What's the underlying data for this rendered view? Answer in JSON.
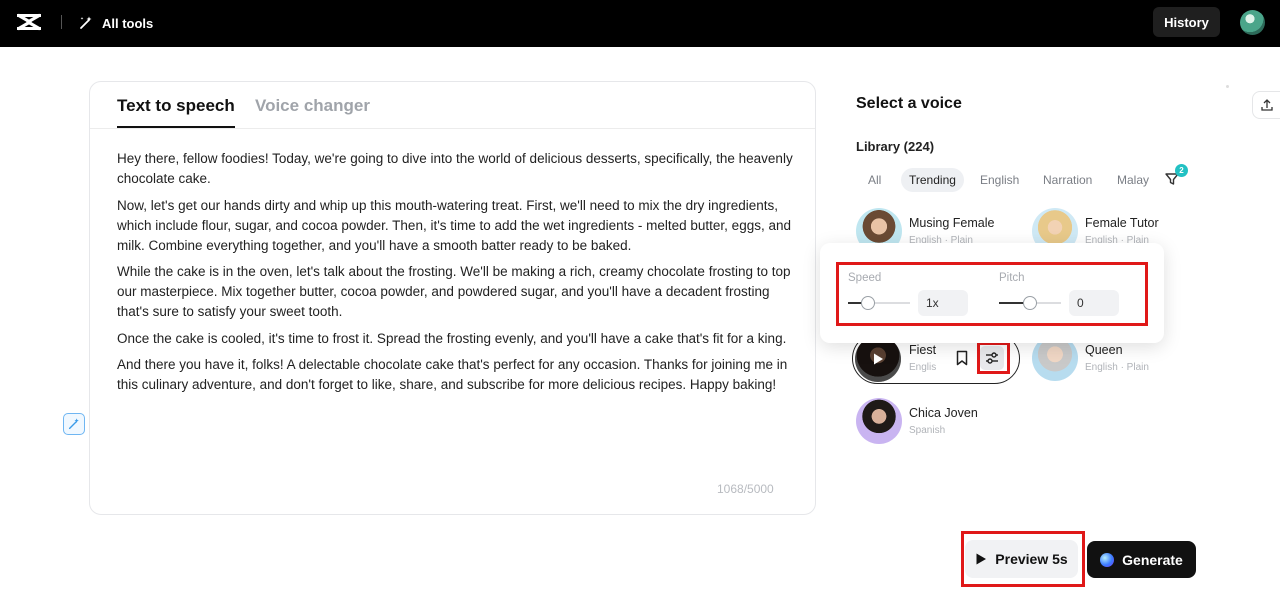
{
  "topbar": {
    "all_tools_label": "All tools",
    "history_label": "History",
    "logo_icon": "capcut-logo-icon",
    "all_tools_icon": "magic-wand-icon"
  },
  "editor": {
    "tabs": [
      {
        "label": "Text to speech",
        "active": true
      },
      {
        "label": "Voice changer",
        "active": false
      }
    ],
    "paragraphs": [
      "Hey there, fellow foodies! Today, we're going to dive into the world of delicious desserts, specifically, the heavenly chocolate cake.",
      "Now, let's get our hands dirty and whip up this mouth-watering treat. First, we'll need to mix the dry ingredients, which include flour, sugar, and cocoa powder. Then, it's time to add the wet ingredients - melted butter, eggs, and milk. Combine everything together, and you'll have a smooth batter ready to be baked.",
      "While the cake is in the oven, let's talk about the frosting. We'll be making a rich, creamy chocolate frosting to top our masterpiece. Mix together butter, cocoa powder, and powdered sugar, and you'll have a decadent frosting that's sure to satisfy your sweet tooth.",
      "Once the cake is cooled, it's time to frost it. Spread the frosting evenly, and you'll have a cake that's fit for a king.",
      "And there you have it, folks! A delectable chocolate cake that's perfect for any occasion. Thanks for joining me in this culinary adventure, and don't forget to like, share, and subscribe for more delicious recipes. Happy baking!"
    ],
    "char_count": "1068/5000"
  },
  "voice_panel": {
    "title": "Select a voice",
    "library_label": "Library (224)",
    "filters": [
      "All",
      "Trending",
      "English",
      "Narration",
      "Malay"
    ],
    "active_filter": "Trending",
    "filter_badge": "2",
    "voices": [
      {
        "name": "Musing Female",
        "meta": "English · Plain"
      },
      {
        "name": "Female Tutor",
        "meta": "English · Plain"
      },
      {
        "name": "Fiesta",
        "meta": "English"
      },
      {
        "name": "Queen",
        "meta": "English · Plain"
      },
      {
        "name": "Chica Joven",
        "meta": "Spanish"
      }
    ],
    "selected_voice_short": "Fiest",
    "selected_voice_meta_short": "Englis"
  },
  "settings_popup": {
    "speed_label": "Speed",
    "speed_value": "1x",
    "speed_level": 0.33,
    "pitch_label": "Pitch",
    "pitch_value": "0",
    "pitch_level": 0.5
  },
  "actions": {
    "preview_label": "Preview 5s",
    "generate_label": "Generate"
  },
  "colors": {
    "highlight": "#e01818",
    "accent_badge": "#22c1c3"
  }
}
